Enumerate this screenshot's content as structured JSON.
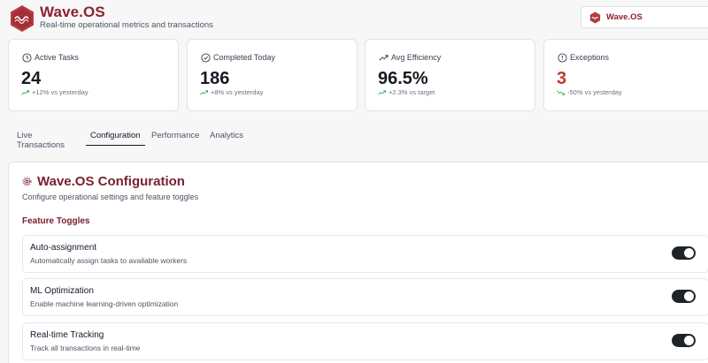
{
  "header": {
    "title": "Wave.OS",
    "subtitle": "Real-time operational metrics and transactions",
    "logo_icon": "hexagon-wave-logo",
    "brand_color": "#8b2230"
  },
  "selector": {
    "selected": "Wave.OS",
    "icon": "hexagon-wave-logo"
  },
  "stats": [
    {
      "label": "Active Tasks",
      "value": "24",
      "trend": "+12% vs yesterday",
      "icon": "clock-icon"
    },
    {
      "label": "Completed Today",
      "value": "186",
      "trend": "+8% vs yesterday",
      "icon": "check-circle-icon"
    },
    {
      "label": "Avg Efficiency",
      "value": "96.5%",
      "trend": "+2.3% vs target",
      "icon": "trend-up-icon"
    },
    {
      "label": "Exceptions",
      "value": "3",
      "trend": "-50% vs yesterday",
      "icon": "alert-circle-icon",
      "value_color": "#c0392b"
    }
  ],
  "tabs": [
    {
      "label": "Live Transactions",
      "active": false
    },
    {
      "label": "Configuration",
      "active": true
    },
    {
      "label": "Performance",
      "active": false
    },
    {
      "label": "Analytics",
      "active": false
    }
  ],
  "config": {
    "title": "Wave.OS Configuration",
    "description": "Configure operational settings and feature toggles",
    "section_title": "Feature Toggles",
    "toggles": [
      {
        "name": "Auto-assignment",
        "description": "Automatically assign tasks to available workers",
        "enabled": true
      },
      {
        "name": "ML Optimization",
        "description": "Enable machine learning-driven optimization",
        "enabled": true
      },
      {
        "name": "Real-time Tracking",
        "description": "Track all transactions in real-time",
        "enabled": true
      }
    ]
  }
}
